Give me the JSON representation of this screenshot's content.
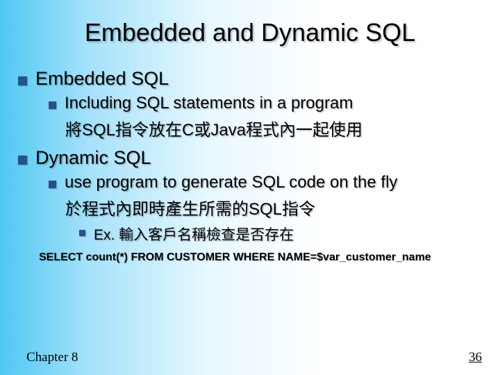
{
  "title": "Embedded and Dynamic SQL",
  "bullets": {
    "embedded": {
      "heading": "Embedded SQL",
      "sub": {
        "line1": "Including SQL statements in a program",
        "line2": "將SQL指令放在C或Java程式內一起使用"
      }
    },
    "dynamic": {
      "heading": "Dynamic SQL",
      "sub": {
        "line1": "use program to generate SQL code on the fly",
        "line2": "於程式內即時產生所需的SQL指令"
      },
      "ex": "Ex. 輸入客戶名稱檢查是否存在"
    }
  },
  "code": "SELECT count(*) FROM CUSTOMER WHERE NAME=$var_customer_name",
  "footer": {
    "left": "Chapter 8",
    "right": "36"
  }
}
